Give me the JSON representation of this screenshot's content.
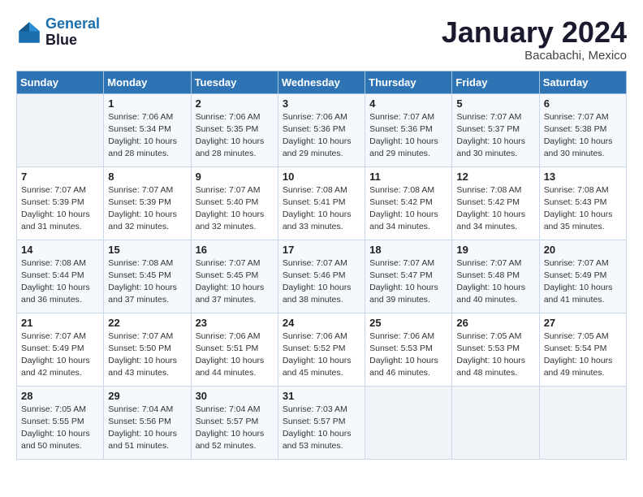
{
  "logo": {
    "line1": "General",
    "line2": "Blue"
  },
  "title": "January 2024",
  "location": "Bacabachi, Mexico",
  "days_header": [
    "Sunday",
    "Monday",
    "Tuesday",
    "Wednesday",
    "Thursday",
    "Friday",
    "Saturday"
  ],
  "weeks": [
    [
      {
        "num": "",
        "sunrise": "",
        "sunset": "",
        "daylight": ""
      },
      {
        "num": "1",
        "sunrise": "Sunrise: 7:06 AM",
        "sunset": "Sunset: 5:34 PM",
        "daylight": "Daylight: 10 hours and 28 minutes."
      },
      {
        "num": "2",
        "sunrise": "Sunrise: 7:06 AM",
        "sunset": "Sunset: 5:35 PM",
        "daylight": "Daylight: 10 hours and 28 minutes."
      },
      {
        "num": "3",
        "sunrise": "Sunrise: 7:06 AM",
        "sunset": "Sunset: 5:36 PM",
        "daylight": "Daylight: 10 hours and 29 minutes."
      },
      {
        "num": "4",
        "sunrise": "Sunrise: 7:07 AM",
        "sunset": "Sunset: 5:36 PM",
        "daylight": "Daylight: 10 hours and 29 minutes."
      },
      {
        "num": "5",
        "sunrise": "Sunrise: 7:07 AM",
        "sunset": "Sunset: 5:37 PM",
        "daylight": "Daylight: 10 hours and 30 minutes."
      },
      {
        "num": "6",
        "sunrise": "Sunrise: 7:07 AM",
        "sunset": "Sunset: 5:38 PM",
        "daylight": "Daylight: 10 hours and 30 minutes."
      }
    ],
    [
      {
        "num": "7",
        "sunrise": "Sunrise: 7:07 AM",
        "sunset": "Sunset: 5:39 PM",
        "daylight": "Daylight: 10 hours and 31 minutes."
      },
      {
        "num": "8",
        "sunrise": "Sunrise: 7:07 AM",
        "sunset": "Sunset: 5:39 PM",
        "daylight": "Daylight: 10 hours and 32 minutes."
      },
      {
        "num": "9",
        "sunrise": "Sunrise: 7:07 AM",
        "sunset": "Sunset: 5:40 PM",
        "daylight": "Daylight: 10 hours and 32 minutes."
      },
      {
        "num": "10",
        "sunrise": "Sunrise: 7:08 AM",
        "sunset": "Sunset: 5:41 PM",
        "daylight": "Daylight: 10 hours and 33 minutes."
      },
      {
        "num": "11",
        "sunrise": "Sunrise: 7:08 AM",
        "sunset": "Sunset: 5:42 PM",
        "daylight": "Daylight: 10 hours and 34 minutes."
      },
      {
        "num": "12",
        "sunrise": "Sunrise: 7:08 AM",
        "sunset": "Sunset: 5:42 PM",
        "daylight": "Daylight: 10 hours and 34 minutes."
      },
      {
        "num": "13",
        "sunrise": "Sunrise: 7:08 AM",
        "sunset": "Sunset: 5:43 PM",
        "daylight": "Daylight: 10 hours and 35 minutes."
      }
    ],
    [
      {
        "num": "14",
        "sunrise": "Sunrise: 7:08 AM",
        "sunset": "Sunset: 5:44 PM",
        "daylight": "Daylight: 10 hours and 36 minutes."
      },
      {
        "num": "15",
        "sunrise": "Sunrise: 7:08 AM",
        "sunset": "Sunset: 5:45 PM",
        "daylight": "Daylight: 10 hours and 37 minutes."
      },
      {
        "num": "16",
        "sunrise": "Sunrise: 7:07 AM",
        "sunset": "Sunset: 5:45 PM",
        "daylight": "Daylight: 10 hours and 37 minutes."
      },
      {
        "num": "17",
        "sunrise": "Sunrise: 7:07 AM",
        "sunset": "Sunset: 5:46 PM",
        "daylight": "Daylight: 10 hours and 38 minutes."
      },
      {
        "num": "18",
        "sunrise": "Sunrise: 7:07 AM",
        "sunset": "Sunset: 5:47 PM",
        "daylight": "Daylight: 10 hours and 39 minutes."
      },
      {
        "num": "19",
        "sunrise": "Sunrise: 7:07 AM",
        "sunset": "Sunset: 5:48 PM",
        "daylight": "Daylight: 10 hours and 40 minutes."
      },
      {
        "num": "20",
        "sunrise": "Sunrise: 7:07 AM",
        "sunset": "Sunset: 5:49 PM",
        "daylight": "Daylight: 10 hours and 41 minutes."
      }
    ],
    [
      {
        "num": "21",
        "sunrise": "Sunrise: 7:07 AM",
        "sunset": "Sunset: 5:49 PM",
        "daylight": "Daylight: 10 hours and 42 minutes."
      },
      {
        "num": "22",
        "sunrise": "Sunrise: 7:07 AM",
        "sunset": "Sunset: 5:50 PM",
        "daylight": "Daylight: 10 hours and 43 minutes."
      },
      {
        "num": "23",
        "sunrise": "Sunrise: 7:06 AM",
        "sunset": "Sunset: 5:51 PM",
        "daylight": "Daylight: 10 hours and 44 minutes."
      },
      {
        "num": "24",
        "sunrise": "Sunrise: 7:06 AM",
        "sunset": "Sunset: 5:52 PM",
        "daylight": "Daylight: 10 hours and 45 minutes."
      },
      {
        "num": "25",
        "sunrise": "Sunrise: 7:06 AM",
        "sunset": "Sunset: 5:53 PM",
        "daylight": "Daylight: 10 hours and 46 minutes."
      },
      {
        "num": "26",
        "sunrise": "Sunrise: 7:05 AM",
        "sunset": "Sunset: 5:53 PM",
        "daylight": "Daylight: 10 hours and 48 minutes."
      },
      {
        "num": "27",
        "sunrise": "Sunrise: 7:05 AM",
        "sunset": "Sunset: 5:54 PM",
        "daylight": "Daylight: 10 hours and 49 minutes."
      }
    ],
    [
      {
        "num": "28",
        "sunrise": "Sunrise: 7:05 AM",
        "sunset": "Sunset: 5:55 PM",
        "daylight": "Daylight: 10 hours and 50 minutes."
      },
      {
        "num": "29",
        "sunrise": "Sunrise: 7:04 AM",
        "sunset": "Sunset: 5:56 PM",
        "daylight": "Daylight: 10 hours and 51 minutes."
      },
      {
        "num": "30",
        "sunrise": "Sunrise: 7:04 AM",
        "sunset": "Sunset: 5:57 PM",
        "daylight": "Daylight: 10 hours and 52 minutes."
      },
      {
        "num": "31",
        "sunrise": "Sunrise: 7:03 AM",
        "sunset": "Sunset: 5:57 PM",
        "daylight": "Daylight: 10 hours and 53 minutes."
      },
      {
        "num": "",
        "sunrise": "",
        "sunset": "",
        "daylight": ""
      },
      {
        "num": "",
        "sunrise": "",
        "sunset": "",
        "daylight": ""
      },
      {
        "num": "",
        "sunrise": "",
        "sunset": "",
        "daylight": ""
      }
    ]
  ]
}
